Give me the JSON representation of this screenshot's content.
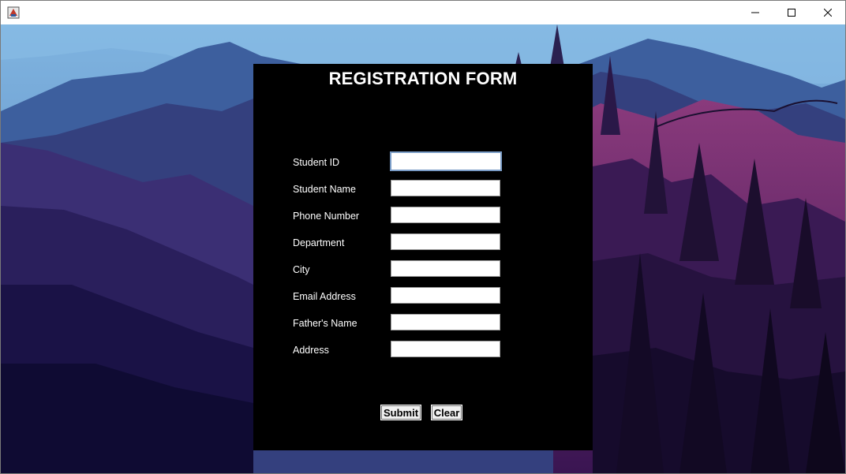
{
  "window": {
    "app_icon": "java-app-icon",
    "controls": [
      "minimize-icon",
      "maximize-icon",
      "close-icon"
    ]
  },
  "form": {
    "title": "REGISTRATION FORM",
    "fields": [
      {
        "label": "Student ID",
        "value": ""
      },
      {
        "label": "Student Name",
        "value": ""
      },
      {
        "label": "Phone Number",
        "value": ""
      },
      {
        "label": "Department",
        "value": ""
      },
      {
        "label": "City",
        "value": ""
      },
      {
        "label": "Email Address",
        "value": ""
      },
      {
        "label": "Father's Name",
        "value": ""
      },
      {
        "label": "Address",
        "value": ""
      }
    ],
    "submit_label": "Submit",
    "clear_label": "Clear"
  },
  "colors": {
    "panel": "#000000",
    "text": "#ffffff",
    "sky": "#6fa7d8",
    "mountain_far": "#3e5a9a",
    "mountain_mid": "#4a3a86",
    "foreground": "#1a1040"
  }
}
